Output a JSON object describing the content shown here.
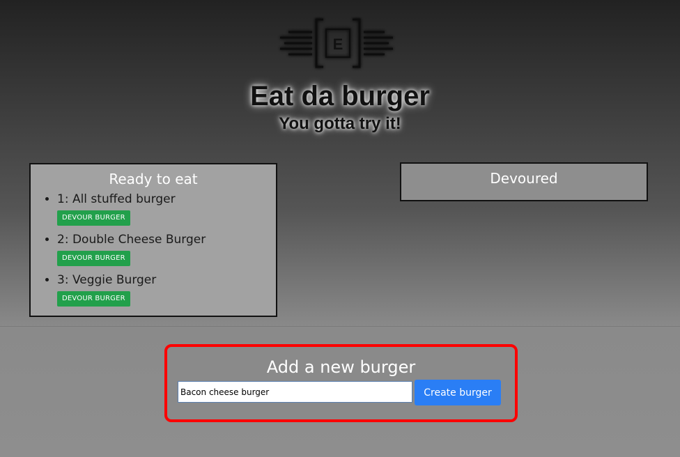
{
  "header": {
    "logo_letter": "E",
    "title": "Eat da burger",
    "subtitle": "You gotta try it!"
  },
  "ready_panel": {
    "title": "Ready to eat",
    "items": [
      {
        "label": "1: All stuffed burger",
        "button": "DEVOUR BURGER"
      },
      {
        "label": "2: Double Cheese Burger",
        "button": "DEVOUR BURGER"
      },
      {
        "label": "3: Veggie Burger",
        "button": "DEVOUR BURGER"
      }
    ]
  },
  "devoured_panel": {
    "title": "Devoured",
    "items": []
  },
  "add_form": {
    "title": "Add a new burger",
    "input_value": "Bacon cheese burger",
    "submit_label": "Create burger"
  },
  "colors": {
    "devour_button": "#22a04b",
    "create_button": "#2a7ef5",
    "highlight_border": "#ff0000"
  },
  "icons": {
    "logo": "e-logo-icon"
  }
}
